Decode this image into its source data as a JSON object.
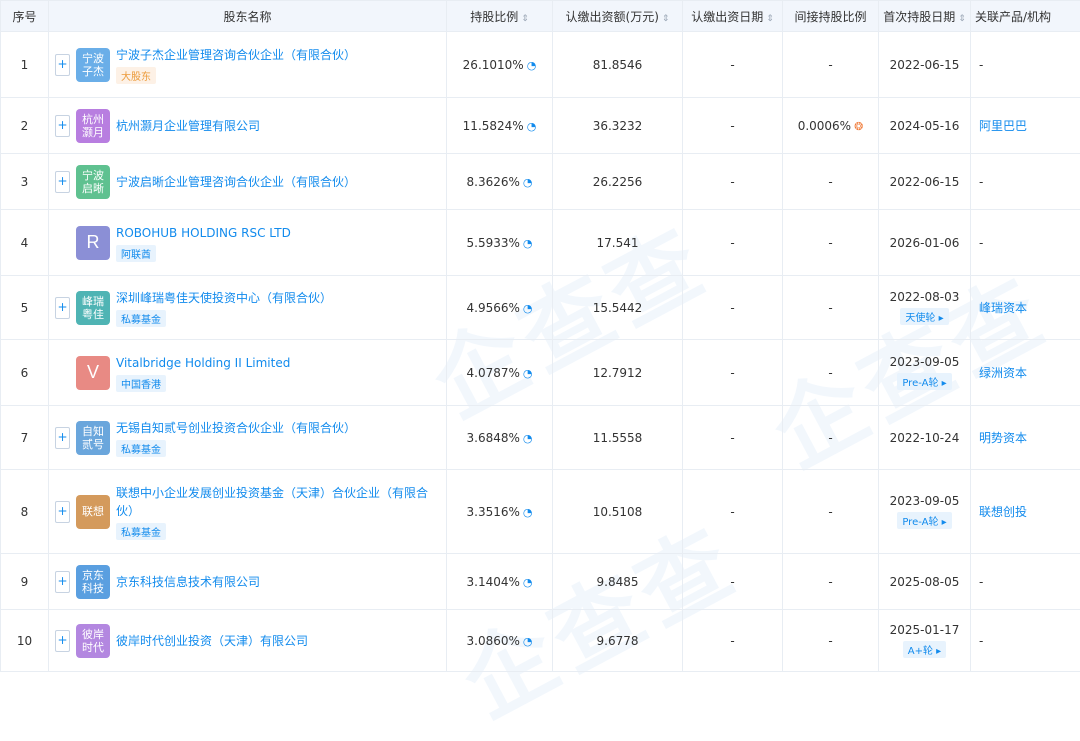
{
  "header": {
    "seq": "序号",
    "name": "股东名称",
    "ratio": "持股比例",
    "capital": "认缴出资额(万元)",
    "date": "认缴出资日期",
    "indirect": "间接持股比例",
    "first_date": "首次持股日期",
    "related": "关联产品/机构"
  },
  "rows": [
    {
      "seq": "1",
      "logo": "宁波子杰",
      "logo_color": "#6aaee8",
      "name": "宁波子杰企业管理咨询合伙企业（有限合伙）",
      "tag": "大股东",
      "tag_type": "big",
      "ratio": "26.1010%",
      "capital": "81.8546",
      "date": "-",
      "indirect": "-",
      "first_date": "2022-06-15",
      "round": "",
      "related": "-",
      "expand": true
    },
    {
      "seq": "2",
      "logo": "杭州灏月",
      "logo_color": "#b87ee0",
      "name": "杭州灏月企业管理有限公司",
      "tag": "",
      "tag_type": "",
      "ratio": "11.5824%",
      "capital": "36.3232",
      "date": "-",
      "indirect": "0.0006%",
      "first_date": "2024-05-16",
      "round": "",
      "related": "阿里巴巴",
      "expand": true
    },
    {
      "seq": "3",
      "logo": "宁波启晰",
      "logo_color": "#5fc190",
      "name": "宁波启晰企业管理咨询合伙企业（有限合伙）",
      "tag": "",
      "tag_type": "",
      "ratio": "8.3626%",
      "capital": "26.2256",
      "date": "-",
      "indirect": "-",
      "first_date": "2022-06-15",
      "round": "",
      "related": "-",
      "expand": true
    },
    {
      "seq": "4",
      "logo": "R",
      "logo_color": "#8b8fd6",
      "name": "ROBOHUB HOLDING RSC LTD",
      "tag": "阿联酋",
      "tag_type": "",
      "ratio": "5.5933%",
      "capital": "17.541",
      "date": "-",
      "indirect": "-",
      "first_date": "2026-01-06",
      "round": "",
      "related": "-",
      "expand": false
    },
    {
      "seq": "5",
      "logo": "峰瑞粤佳",
      "logo_color": "#4fb4b4",
      "name": "深圳峰瑞粤佳天使投资中心（有限合伙）",
      "tag": "私募基金",
      "tag_type": "",
      "ratio": "4.9566%",
      "capital": "15.5442",
      "date": "-",
      "indirect": "-",
      "first_date": "2022-08-03",
      "round": "天使轮 ▸",
      "related": "峰瑞资本",
      "expand": true
    },
    {
      "seq": "6",
      "logo": "V",
      "logo_color": "#e88a84",
      "name": "Vitalbridge Holding II Limited",
      "tag": "中国香港",
      "tag_type": "",
      "ratio": "4.0787%",
      "capital": "12.7912",
      "date": "-",
      "indirect": "-",
      "first_date": "2023-09-05",
      "round": "Pre-A轮 ▸",
      "related": "绿洲资本",
      "expand": false
    },
    {
      "seq": "7",
      "logo": "自知贰号",
      "logo_color": "#6aa6dc",
      "name": "无锡自知贰号创业投资合伙企业（有限合伙）",
      "tag": "私募基金",
      "tag_type": "",
      "ratio": "3.6848%",
      "capital": "11.5558",
      "date": "-",
      "indirect": "-",
      "first_date": "2022-10-24",
      "round": "",
      "related": "明势资本",
      "expand": true
    },
    {
      "seq": "8",
      "logo": "联想",
      "logo_color": "#d49a5c",
      "name": "联想中小企业发展创业投资基金（天津）合伙企业（有限合伙）",
      "tag": "私募基金",
      "tag_type": "",
      "ratio": "3.3516%",
      "capital": "10.5108",
      "date": "-",
      "indirect": "-",
      "first_date": "2023-09-05",
      "round": "Pre-A轮 ▸",
      "related": "联想创投",
      "expand": true
    },
    {
      "seq": "9",
      "logo": "京东科技",
      "logo_color": "#5a9fe0",
      "name": "京东科技信息技术有限公司",
      "tag": "",
      "tag_type": "",
      "ratio": "3.1404%",
      "capital": "9.8485",
      "date": "-",
      "indirect": "-",
      "first_date": "2025-08-05",
      "round": "",
      "related": "-",
      "expand": true
    },
    {
      "seq": "10",
      "logo": "彼岸时代",
      "logo_color": "#b387e0",
      "name": "彼岸时代创业投资（天津）有限公司",
      "tag": "",
      "tag_type": "",
      "ratio": "3.0860%",
      "capital": "9.6778",
      "date": "-",
      "indirect": "-",
      "first_date": "2025-01-17",
      "round": "A+轮 ▸",
      "related": "-",
      "expand": true
    }
  ],
  "icons": {
    "sort": "sort-icon",
    "pct": "pie-chart-icon",
    "pct_alt": "share-penetration-icon",
    "expand": "plus-icon"
  },
  "sort_glyph": "⇕",
  "pct_glyph": "◔",
  "pct_alt_glyph": "❂",
  "expand_glyph": "+"
}
